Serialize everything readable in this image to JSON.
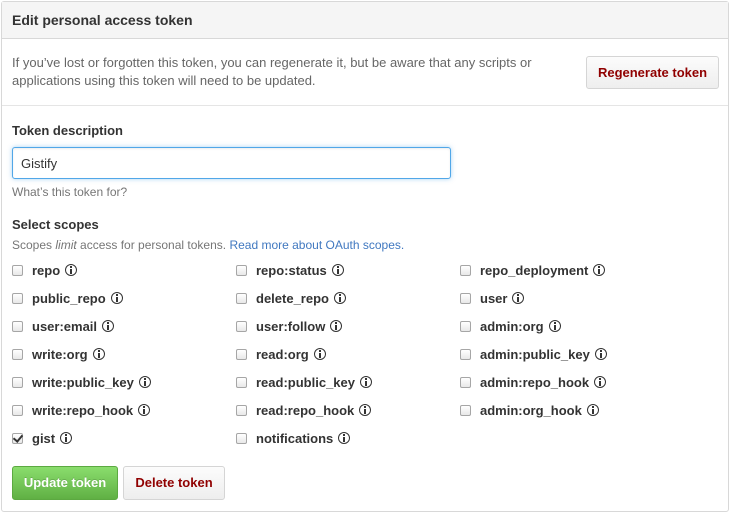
{
  "panel": {
    "title": "Edit personal access token"
  },
  "notice": {
    "text": "If you’ve lost or forgotten this token, you can regenerate it, but be aware that any scripts or applications using this token will need to be updated.",
    "regenerate_label": "Regenerate token"
  },
  "description": {
    "label": "Token description",
    "value": "Gistify",
    "hint": "What’s this token for?"
  },
  "scopes": {
    "label": "Select scopes",
    "note_prefix": "Scopes ",
    "note_emphasis": "limit",
    "note_suffix": " access for personal tokens. ",
    "note_link": "Read more about OAuth scopes.",
    "items": [
      {
        "label": "repo",
        "checked": false
      },
      {
        "label": "repo:status",
        "checked": false
      },
      {
        "label": "repo_deployment",
        "checked": false
      },
      {
        "label": "public_repo",
        "checked": false
      },
      {
        "label": "delete_repo",
        "checked": false
      },
      {
        "label": "user",
        "checked": false
      },
      {
        "label": "user:email",
        "checked": false
      },
      {
        "label": "user:follow",
        "checked": false
      },
      {
        "label": "admin:org",
        "checked": false
      },
      {
        "label": "write:org",
        "checked": false
      },
      {
        "label": "read:org",
        "checked": false
      },
      {
        "label": "admin:public_key",
        "checked": false
      },
      {
        "label": "write:public_key",
        "checked": false
      },
      {
        "label": "read:public_key",
        "checked": false
      },
      {
        "label": "admin:repo_hook",
        "checked": false
      },
      {
        "label": "write:repo_hook",
        "checked": false
      },
      {
        "label": "read:repo_hook",
        "checked": false
      },
      {
        "label": "admin:org_hook",
        "checked": false
      },
      {
        "label": "gist",
        "checked": true
      },
      {
        "label": "notifications",
        "checked": false
      }
    ]
  },
  "actions": {
    "update_label": "Update token",
    "delete_label": "Delete token"
  }
}
